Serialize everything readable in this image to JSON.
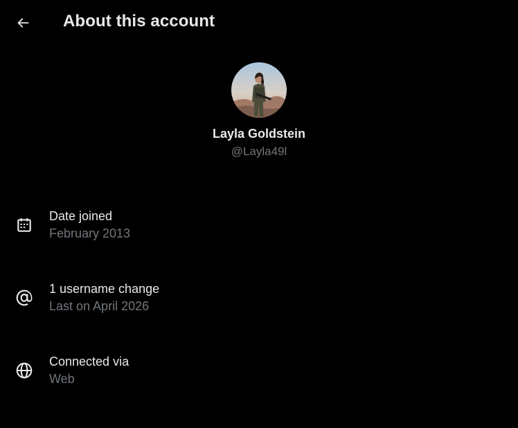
{
  "header": {
    "title": "About this account",
    "back_icon": "arrow-left-icon"
  },
  "profile": {
    "display_name": "Layla Goldstein",
    "handle": "@Layla49l",
    "avatar_icon": "profile-photo"
  },
  "details": [
    {
      "icon": "calendar-icon",
      "title": "Date joined",
      "value": "February 2013"
    },
    {
      "icon": "at-sign-icon",
      "title": "1 username change",
      "value": "Last on April 2026"
    },
    {
      "icon": "globe-icon",
      "title": "Connected via",
      "value": "Web"
    }
  ],
  "colors": {
    "background": "#000000",
    "primary_text": "#e7e9ea",
    "secondary_text": "#71767b"
  }
}
